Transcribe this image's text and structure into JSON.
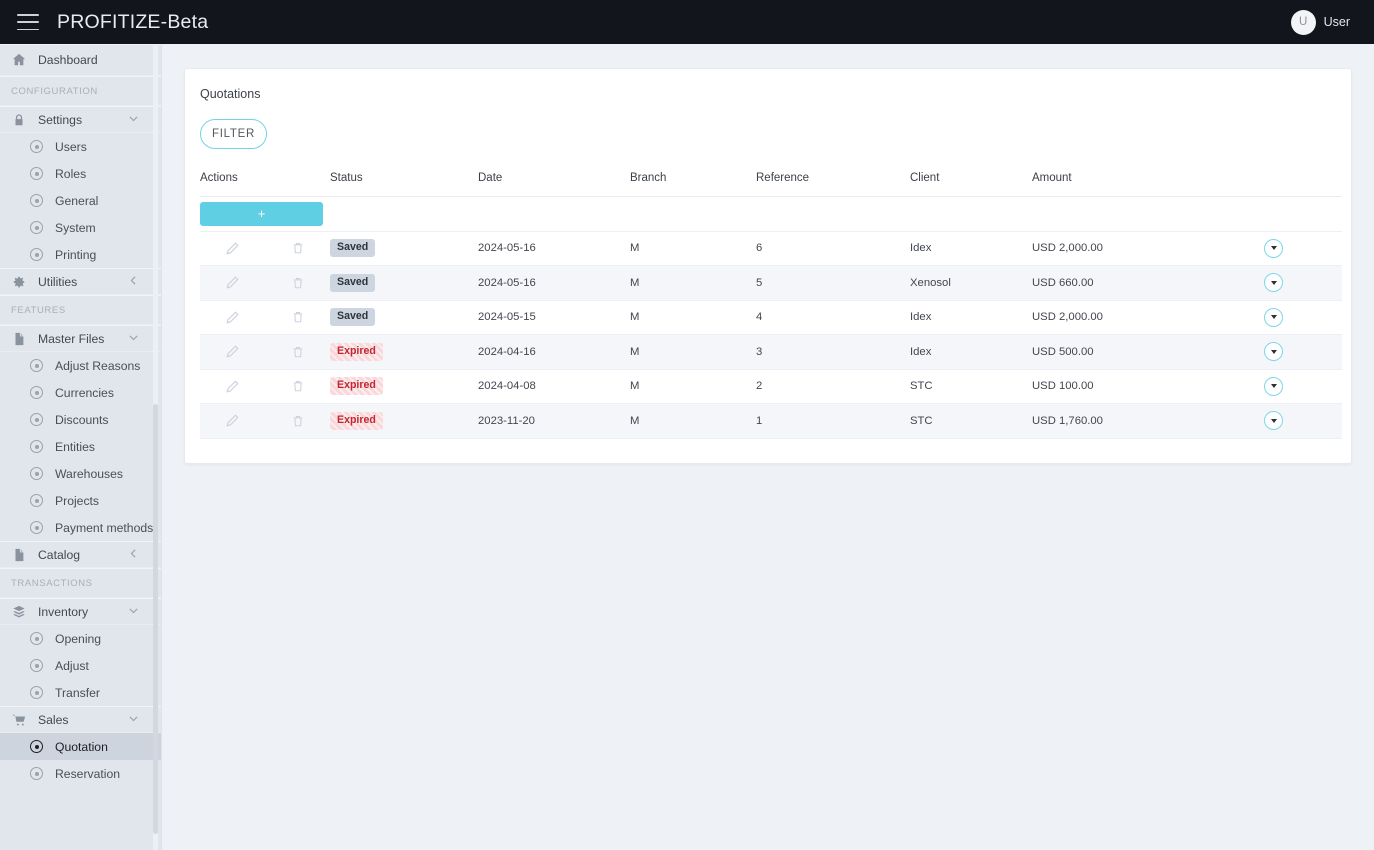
{
  "header": {
    "menu_icon": "hamburger-icon",
    "title": "PROFITIZE-Beta",
    "user": {
      "initial": "U",
      "name": "User"
    }
  },
  "sidebar": {
    "dashboard": {
      "label": "Dashboard",
      "icon": "home-icon"
    },
    "sections": [
      {
        "section_label": "CONFIGURATION",
        "groups": [
          {
            "label": "Settings",
            "icon": "lock-icon",
            "state": "expanded",
            "caret": "chevron-down-icon",
            "children": [
              {
                "label": "Users"
              },
              {
                "label": "Roles"
              },
              {
                "label": "General"
              },
              {
                "label": "System"
              },
              {
                "label": "Printing"
              }
            ]
          },
          {
            "label": "Utilities",
            "icon": "gear-icon",
            "state": "collapsed",
            "caret": "chevron-left-icon",
            "children": []
          }
        ]
      },
      {
        "section_label": "FEATURES",
        "groups": [
          {
            "label": "Master Files",
            "icon": "file-icon",
            "state": "expanded",
            "caret": "chevron-down-icon",
            "children": [
              {
                "label": "Adjust Reasons"
              },
              {
                "label": "Currencies"
              },
              {
                "label": "Discounts"
              },
              {
                "label": "Entities"
              },
              {
                "label": "Warehouses"
              },
              {
                "label": "Projects"
              },
              {
                "label": "Payment methods"
              }
            ]
          },
          {
            "label": "Catalog",
            "icon": "file-icon",
            "state": "collapsed",
            "caret": "chevron-left-icon",
            "children": []
          }
        ]
      },
      {
        "section_label": "TRANSACTIONS",
        "groups": [
          {
            "label": "Inventory",
            "icon": "layers-icon",
            "state": "expanded",
            "caret": "chevron-down-icon",
            "children": [
              {
                "label": "Opening"
              },
              {
                "label": "Adjust"
              },
              {
                "label": "Transfer"
              }
            ]
          },
          {
            "label": "Sales",
            "icon": "cart-icon",
            "state": "expanded",
            "caret": "chevron-down-icon",
            "children": [
              {
                "label": "Quotation",
                "active": true
              },
              {
                "label": "Reservation"
              }
            ]
          }
        ]
      }
    ]
  },
  "main": {
    "card_title": "Quotations",
    "filter_button": "FILTER",
    "add_button": "+",
    "columns": [
      "Actions",
      "Status",
      "Date",
      "Branch",
      "Reference",
      "Client",
      "Amount"
    ],
    "rows": [
      {
        "status": "Saved",
        "status_type": "saved",
        "date": "2024-05-16",
        "branch": "M",
        "reference": "6",
        "client": "Idex",
        "amount": "USD 2,000.00"
      },
      {
        "status": "Saved",
        "status_type": "saved",
        "date": "2024-05-16",
        "branch": "M",
        "reference": "5",
        "client": "Xenosol",
        "amount": "USD 660.00"
      },
      {
        "status": "Saved",
        "status_type": "saved",
        "date": "2024-05-15",
        "branch": "M",
        "reference": "4",
        "client": "Idex",
        "amount": "USD 2,000.00"
      },
      {
        "status": "Expired",
        "status_type": "expired",
        "date": "2024-04-16",
        "branch": "M",
        "reference": "3",
        "client": "Idex",
        "amount": "USD 500.00"
      },
      {
        "status": "Expired",
        "status_type": "expired",
        "date": "2024-04-08",
        "branch": "M",
        "reference": "2",
        "client": "STC",
        "amount": "USD 100.00"
      },
      {
        "status": "Expired",
        "status_type": "expired",
        "date": "2023-11-20",
        "branch": "M",
        "reference": "1",
        "client": "STC",
        "amount": "USD 1,760.00"
      }
    ]
  },
  "colors": {
    "topbar": "#12151c",
    "sidebar": "#e1e5ec",
    "accent_cyan": "#5fcfe3",
    "badge_saved_bg": "#ccd5e0",
    "badge_expired_bg": "#f9d7da",
    "badge_expired_text": "#c0282f",
    "page_bg": "#eef1f5"
  }
}
